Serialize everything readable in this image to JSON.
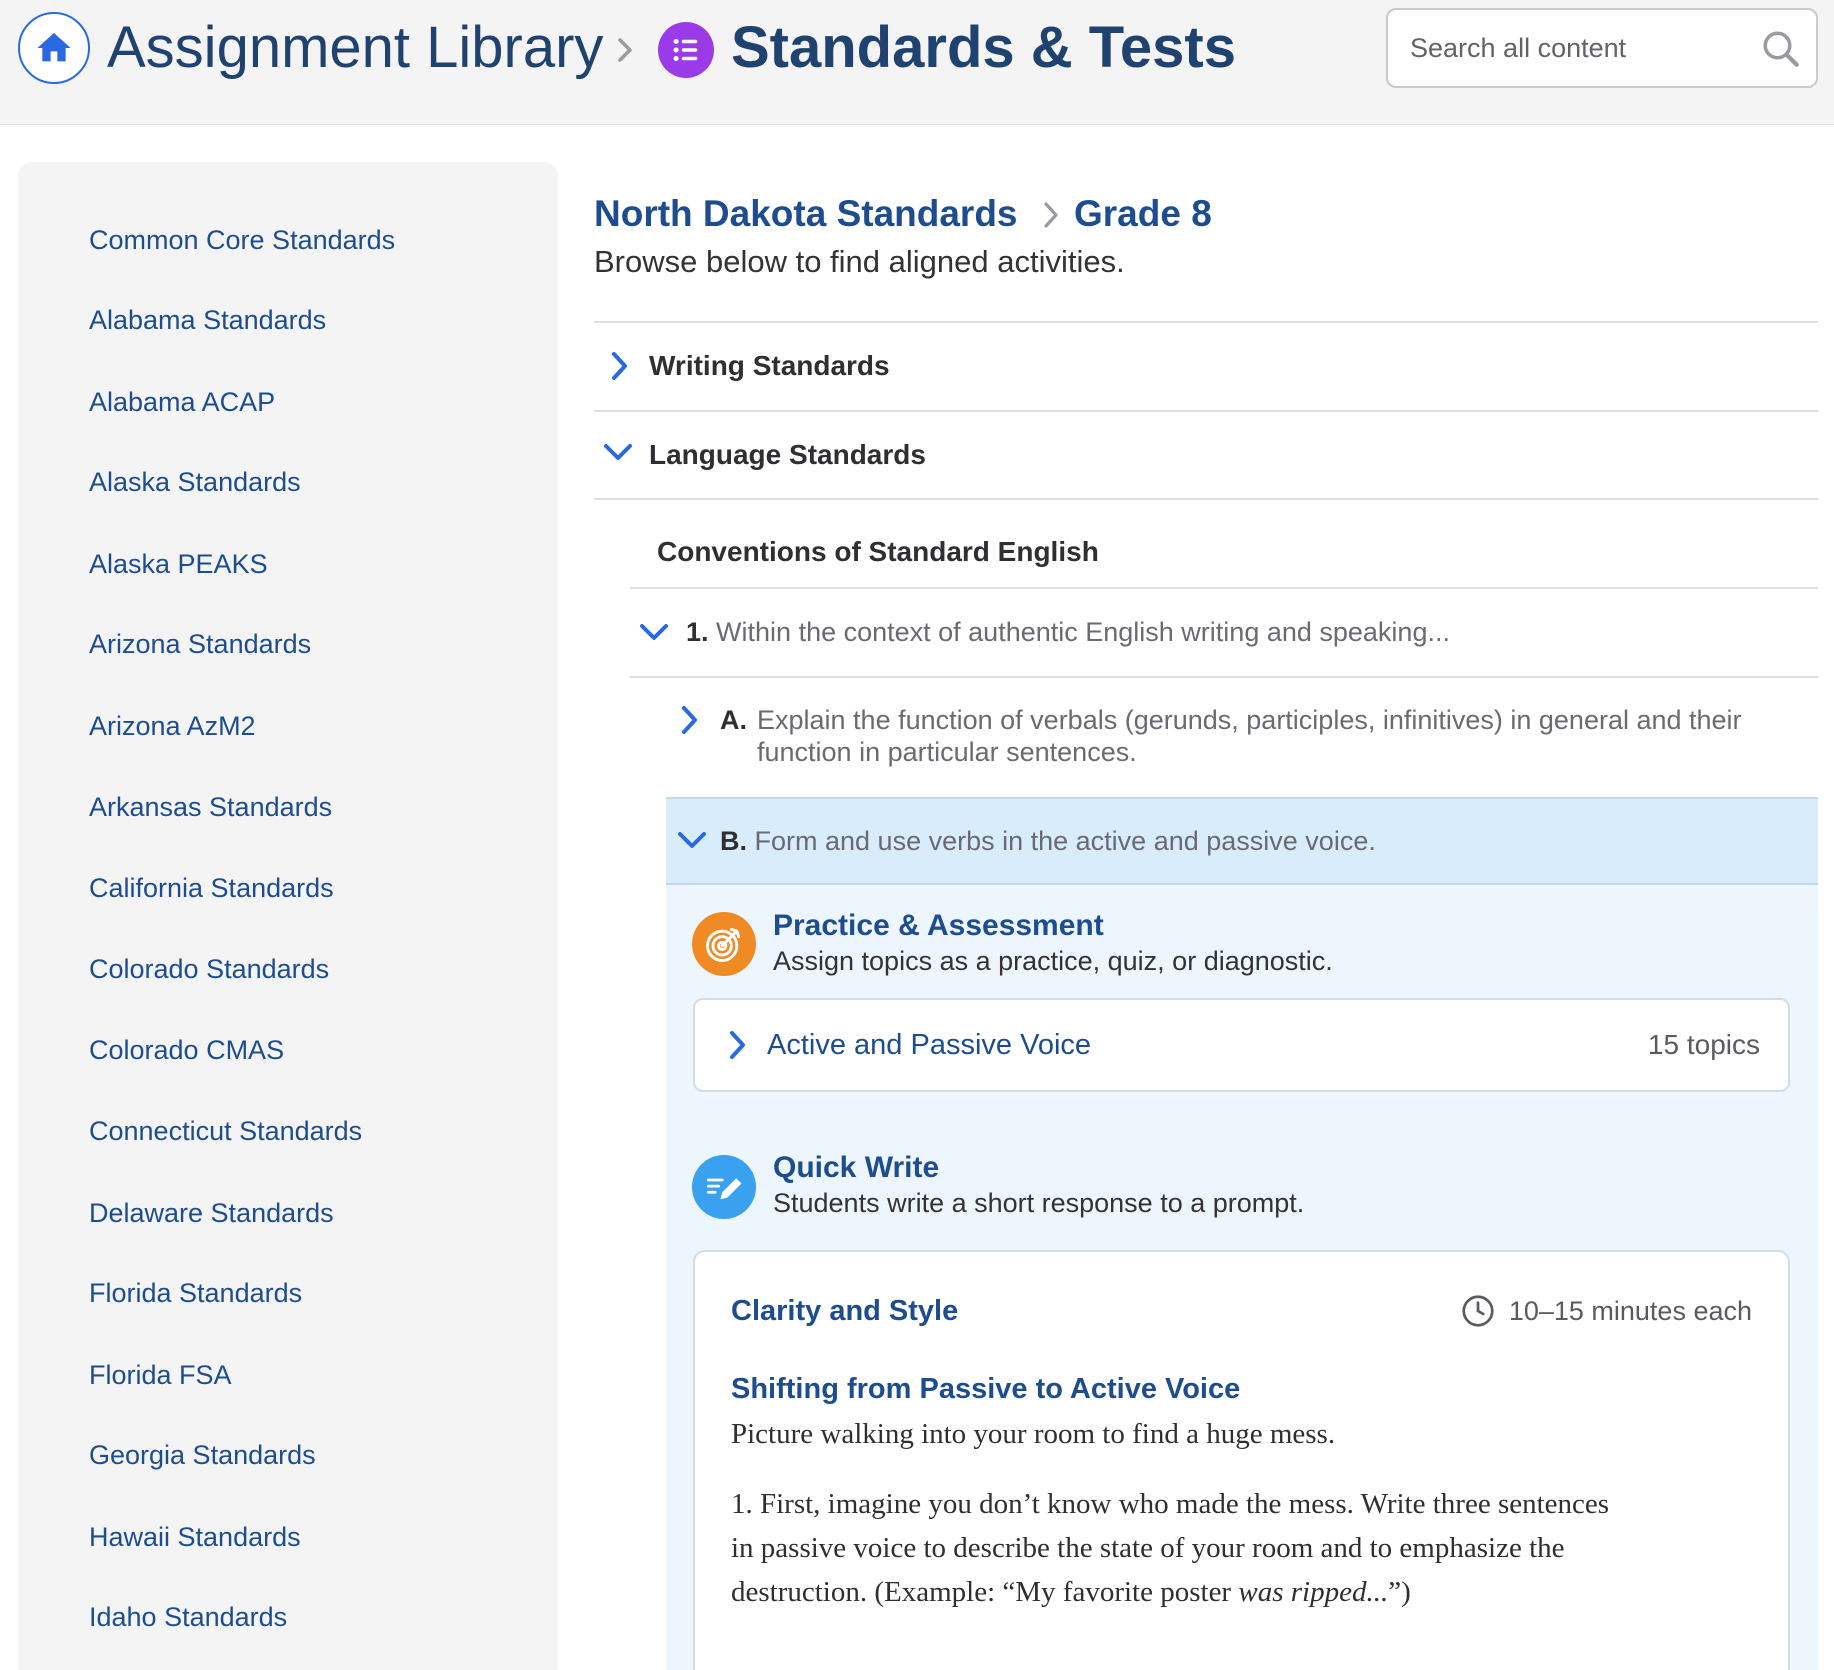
{
  "header": {
    "library_title": "Assignment Library",
    "section_title": "Standards & Tests",
    "search_placeholder": "Search all content",
    "icons": [
      "home-icon",
      "chevron-right-icon",
      "list-icon",
      "search-icon"
    ]
  },
  "sidebar": {
    "items": [
      "Common Core Standards",
      "Alabama Standards",
      "Alabama ACAP",
      "Alaska Standards",
      "Alaska PEAKS",
      "Arizona Standards",
      "Arizona AzM2",
      "Arkansas Standards",
      "California Standards",
      "Colorado Standards",
      "Colorado CMAS",
      "Connecticut Standards",
      "Delaware Standards",
      "Florida Standards",
      "Florida FSA",
      "Georgia Standards",
      "Hawaii Standards",
      "Idaho Standards"
    ]
  },
  "main": {
    "breadcrumb": {
      "standard": "North Dakota Standards",
      "grade": "Grade 8"
    },
    "subtitle": "Browse below to find aligned activities.",
    "sections": {
      "writing": "Writing Standards",
      "language": "Language Standards",
      "conventions": "Conventions of Standard English"
    },
    "item1": {
      "num": "1.",
      "text": "Within the context of authentic English writing and speaking..."
    },
    "itemA": {
      "num": "A.",
      "text": "Explain the function of verbals (gerunds, participles, infinitives) in general and their function in particular sentences."
    },
    "itemB": {
      "num": "B.",
      "text": "Form and use verbs in the active and passive voice."
    },
    "practice": {
      "title": "Practice & Assessment",
      "desc": "Assign topics as a practice, quiz, or diagnostic.",
      "topic_title": "Active and Passive Voice",
      "topic_count": "15 topics"
    },
    "quick_write": {
      "title": "Quick Write",
      "desc": "Students write a short response to a prompt.",
      "category": "Clarity and Style",
      "time": "10–15 minutes each",
      "prompt_title": "Shifting from Passive to Active Voice",
      "intro": "Picture walking into your room to find a huge mess.",
      "body_start": "1. First, imagine you don’t know who made the mess. Write three sentences in passive voice to describe the state of your room and to emphasize the destruction. (Example: “My favorite poster ",
      "body_italic": "was ripped...",
      "body_end": "”)"
    }
  },
  "colors": {
    "accent_blue": "#1d4d8e",
    "home_blue": "#2a6ae0",
    "standards_purple": "#9b3be8",
    "practice_orange": "#f08a24",
    "quickwrite_blue": "#3aa0f0",
    "highlight_bg": "#d9ecfb"
  }
}
